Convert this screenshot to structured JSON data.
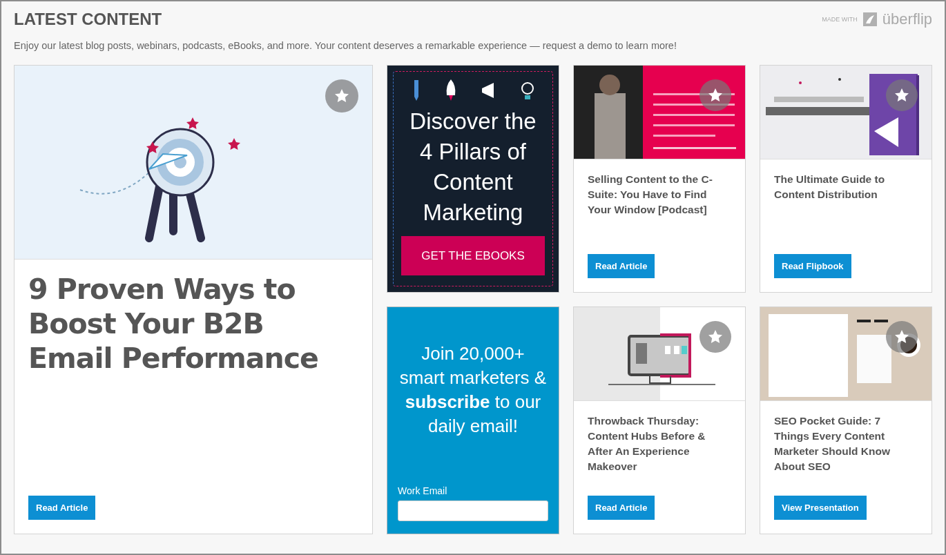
{
  "header": {
    "title": "LATEST CONTENT",
    "made_with": "MADE WITH",
    "brand": "überflip",
    "description": "Enjoy our latest blog posts, webinars, podcasts, eBooks, and more. Your content deserves a remarkable experience — request a demo to learn more!"
  },
  "cards": [
    {
      "kind": "feature",
      "title": "9 Proven Ways to Boost Your B2B Email Performance",
      "button": "Read Article"
    },
    {
      "kind": "promo",
      "heading": "Discover the 4 Pillars of Content Marketing",
      "button": "GET THE EBOOKS"
    },
    {
      "kind": "tile",
      "title": "Selling Content to the C-Suite: You Have to Find Your Window [Podcast]",
      "button": "Read Article"
    },
    {
      "kind": "tile",
      "title": "The Ultimate Guide to Content Distribution",
      "button": "Read Flipbook"
    },
    {
      "kind": "subscribe",
      "heading": "Join 20,000+ smart marketers & **subscribe** to our daily email!",
      "field_label": "Work Email"
    },
    {
      "kind": "tile",
      "title": "Throwback Thursday: Content Hubs Before & After An Experience Makeover",
      "button": "Read Article"
    },
    {
      "kind": "tile",
      "title": "SEO Pocket Guide: 7 Things Every Content Marketer Should Know About SEO",
      "button": "View Presentation"
    }
  ]
}
